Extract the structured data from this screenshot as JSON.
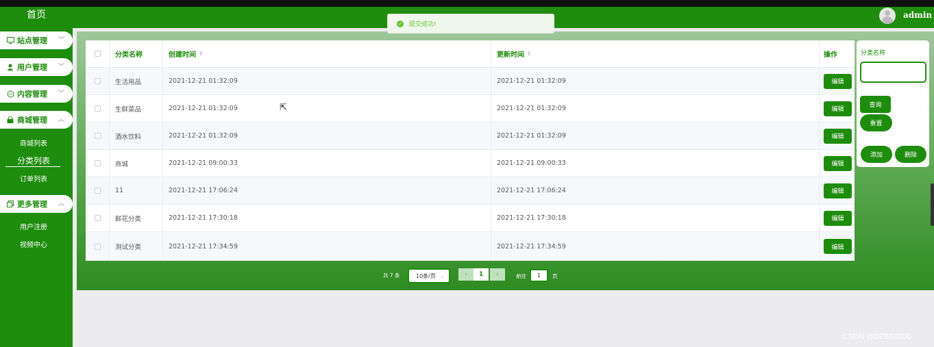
{
  "sidebar": {
    "home": "首页",
    "menus": [
      {
        "label": "站点管理",
        "icon": "monitor-icon"
      },
      {
        "label": "用户管理",
        "icon": "user-icon"
      },
      {
        "label": "内容管理",
        "icon": "chat-icon"
      },
      {
        "label": "商城管理",
        "icon": "bag-icon"
      },
      {
        "label": "更多管理",
        "icon": "copy-icon"
      }
    ],
    "shop_sub": [
      "商城列表",
      "分类列表",
      "订单列表"
    ],
    "more_sub": [
      "用户注册",
      "视频中心"
    ]
  },
  "header": {
    "user": "admin"
  },
  "toast": {
    "message": "提交成功!"
  },
  "table": {
    "headers": {
      "name": "分类名称",
      "created": "创建时间",
      "updated": "更新时间",
      "action": "操作"
    },
    "edit_label": "编辑",
    "rows": [
      {
        "name": "生活用品",
        "created": "2021-12-21 01:32:09",
        "updated": "2021-12-21 01:32:09"
      },
      {
        "name": "生鲜菜品",
        "created": "2021-12-21 01:32:09",
        "updated": "2021-12-21 01:32:09"
      },
      {
        "name": "酒水饮料",
        "created": "2021-12-21 01:32:09",
        "updated": "2021-12-21 01:32:09"
      },
      {
        "name": "商城",
        "created": "2021-12-21 09:00:33",
        "updated": "2021-12-21 09:00:33"
      },
      {
        "name": "11",
        "created": "2021-12-21 17:06:24",
        "updated": "2021-12-21 17:06:24"
      },
      {
        "name": "鲜花分类",
        "created": "2021-12-21 17:30:18",
        "updated": "2021-12-21 17:30:18"
      },
      {
        "name": "测试分类",
        "created": "2021-12-21 17:34:59",
        "updated": "2021-12-21 17:34:59"
      }
    ]
  },
  "search_panel": {
    "label": "分类名称",
    "input_value": "",
    "query": "查询",
    "reset": "重置",
    "add": "添加",
    "delete": "删除"
  },
  "pagination": {
    "total": "共 7 条",
    "page_size": "10条/页",
    "current_page": "1",
    "goto_prefix": "前往",
    "goto_value": "1",
    "goto_suffix": "页"
  },
  "watermark": "CSDN @DZBS2000",
  "colors": {
    "primary": "#1e8c0d",
    "success": "#67c23a"
  }
}
